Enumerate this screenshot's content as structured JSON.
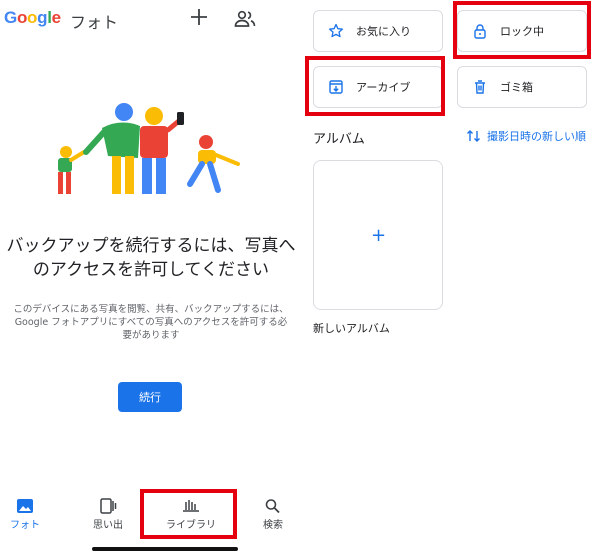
{
  "header": {
    "logo_letters": [
      "G",
      "o",
      "o",
      "g",
      "l",
      "e"
    ],
    "logo_colors": [
      "#4285F4",
      "#EA4335",
      "#FBBC05",
      "#4285F4",
      "#34A853",
      "#EA4335"
    ],
    "app_name": "フォト",
    "add_icon": "plus-icon",
    "share_icon": "people-icon"
  },
  "prompt": {
    "heading": "バックアップを続行するには、写真へのアクセスを許可してください",
    "description": "このデバイスにある写真を閲覧、共有、バックアップするには、Google フォトアプリにすべての写真へのアクセスを許可する必要があります",
    "continue_label": "続行"
  },
  "bottom_nav": {
    "items": [
      {
        "label": "フォト",
        "icon": "photo-icon",
        "active": true
      },
      {
        "label": "思い出",
        "icon": "memories-icon",
        "active": false
      },
      {
        "label": "ライブラリ",
        "icon": "library-icon",
        "active": false
      },
      {
        "label": "検索",
        "icon": "search-icon",
        "active": false
      }
    ]
  },
  "library": {
    "cards": [
      {
        "label": "お気に入り",
        "icon": "star-icon"
      },
      {
        "label": "ロック中",
        "icon": "lock-icon"
      },
      {
        "label": "アーカイブ",
        "icon": "archive-icon"
      },
      {
        "label": "ゴミ箱",
        "icon": "trash-icon"
      }
    ],
    "albums_title": "アルバム",
    "sort_label": "撮影日時の新しい順",
    "sort_icon": "sort-arrows-icon",
    "new_album_plus": "+",
    "new_album_label": "新しいアルバム"
  },
  "colors": {
    "accent": "#1a73e8",
    "highlight_frame": "#e4000f"
  }
}
